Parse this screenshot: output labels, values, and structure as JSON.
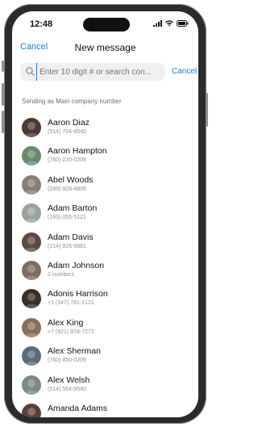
{
  "status": {
    "time": "12:48"
  },
  "nav": {
    "cancel_label": "Cancel",
    "title": "New message"
  },
  "search": {
    "placeholder": "Enter 10 digit # or search con...",
    "cancel_label": "Cancel"
  },
  "sending_label": "Sending as Main company number",
  "contacts": [
    {
      "name": "Aaron Diaz",
      "detail": "(514) 704-9540",
      "color": "#4a3a33"
    },
    {
      "name": "Aaron Hampton",
      "detail": "(760) 220-0209",
      "color": "#6a8a6d"
    },
    {
      "name": "Abel Woods",
      "detail": "(289) 928-4806",
      "color": "#8b7e78"
    },
    {
      "name": "Adam Barton",
      "detail": "(165) 055-5121",
      "color": "#9aa39a"
    },
    {
      "name": "Adam Davis",
      "detail": "(214) 926-9881",
      "color": "#5c4b45"
    },
    {
      "name": "Adam Johnson",
      "detail": "2 numbers",
      "color": "#7d6e64"
    },
    {
      "name": "Adonis Harrison",
      "detail": "+1 (347) 781-2121",
      "color": "#3b2e28"
    },
    {
      "name": "Alex King",
      "detail": "+7 (921) 878-7272",
      "color": "#8a6f5a"
    },
    {
      "name": "Alex Sherman",
      "detail": "(760) 450-0209",
      "color": "#5a6a7a"
    },
    {
      "name": "Alex Welsh",
      "detail": "(514) 564-9540",
      "color": "#7c8a7e"
    },
    {
      "name": "Amanda Adams",
      "detail": "",
      "color": "#5a4038"
    }
  ]
}
